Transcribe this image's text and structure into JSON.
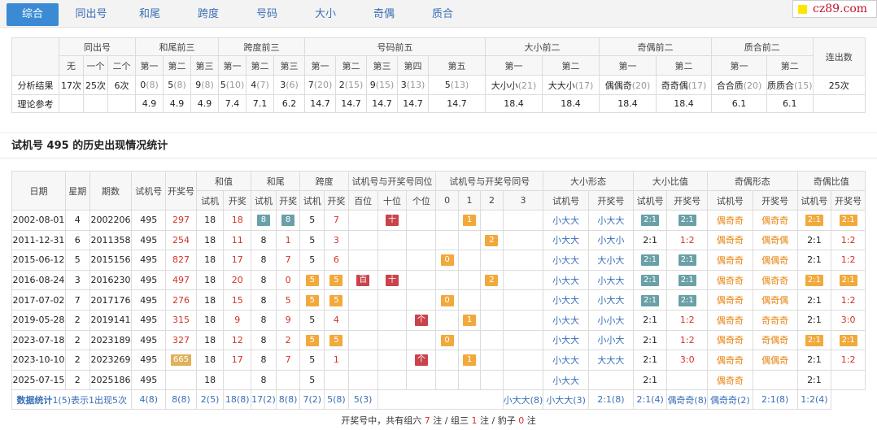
{
  "tabs": [
    "综合",
    "同出号",
    "和尾",
    "跨度",
    "号码",
    "大小",
    "奇偶",
    "质合"
  ],
  "logo": "cz89.com",
  "summary": {
    "groups": [
      "同出号",
      "和尾前三",
      "跨度前三",
      "号码前五",
      "大小前二",
      "奇偶前二",
      "质合前二",
      "连出数"
    ],
    "sub": [
      "无",
      "一个",
      "二个",
      "第一",
      "第二",
      "第三",
      "第一",
      "第二",
      "第三",
      "第一",
      "第二",
      "第三",
      "第四",
      "第五",
      "第一",
      "第二",
      "第一",
      "第二",
      "第一",
      "第二"
    ],
    "row1_label": "分析结果",
    "row1": [
      [
        "17次",
        ""
      ],
      [
        "25次",
        ""
      ],
      [
        "6次",
        ""
      ],
      [
        "0",
        "(8)"
      ],
      [
        "5",
        "(8)"
      ],
      [
        "9",
        "(8)"
      ],
      [
        "5",
        "(10)"
      ],
      [
        "4",
        "(7)"
      ],
      [
        "3",
        "(6)"
      ],
      [
        "7",
        "(20)"
      ],
      [
        "2",
        "(15)"
      ],
      [
        "9",
        "(15)"
      ],
      [
        "3",
        "(13)"
      ],
      [
        "5",
        "(13)"
      ],
      [
        "大小小",
        "(21)"
      ],
      [
        "大大小",
        "(17)"
      ],
      [
        "偶偶奇",
        "(20)"
      ],
      [
        "奇奇偶",
        "(17)"
      ],
      [
        "合合质",
        "(20)"
      ],
      [
        "质质合",
        "(15)"
      ],
      [
        "25次",
        ""
      ]
    ],
    "row2_label": "理论参考",
    "row2": [
      "",
      "",
      "",
      "4.9",
      "4.9",
      "4.9",
      "7.4",
      "7.1",
      "6.2",
      "14.7",
      "14.7",
      "14.7",
      "14.7",
      "14.7",
      "18.4",
      "18.4",
      "18.4",
      "18.4",
      "6.1",
      "6.1",
      ""
    ]
  },
  "section_title": "试机号 495 的历史出现情况统计",
  "hist": {
    "head1": [
      "日期",
      "星期",
      "期数",
      "试机号",
      "开奖号",
      "和值",
      "和尾",
      "跨度",
      "试机号与开奖号同位",
      "试机号与开奖号同号",
      "大小形态",
      "大小比值",
      "奇偶形态",
      "奇偶比值"
    ],
    "head2": [
      "试机",
      "开奖",
      "试机",
      "开奖",
      "试机",
      "开奖",
      "百位",
      "十位",
      "个位",
      "0",
      "1",
      "2",
      "3",
      "试机号",
      "开奖号",
      "试机号",
      "开奖号",
      "试机号",
      "开奖号",
      "试机号",
      "开奖号"
    ],
    "rows": [
      [
        "2002-08-01",
        "4",
        "2002206",
        "495",
        "297",
        "18",
        "18",
        "8",
        "8",
        "5",
        "7",
        "",
        "十",
        "",
        "",
        "1",
        "",
        "",
        "小大大",
        "小大大",
        "2:1",
        "2:1",
        "偶奇奇",
        "偶奇奇",
        "2:1",
        "2:1"
      ],
      [
        "2011-12-31",
        "6",
        "2011358",
        "495",
        "254",
        "18",
        "11",
        "8",
        "1",
        "5",
        "3",
        "",
        "",
        "",
        "",
        "",
        "2",
        "",
        "小大大",
        "小大小",
        "2:1",
        "1:2",
        "偶奇奇",
        "偶奇偶",
        "2:1",
        "1:2"
      ],
      [
        "2015-06-12",
        "5",
        "2015156",
        "495",
        "827",
        "18",
        "17",
        "8",
        "7",
        "5",
        "6",
        "",
        "",
        "",
        "0",
        "",
        "",
        "",
        "小大大",
        "大小大",
        "2:1",
        "2:1",
        "偶奇奇",
        "偶偶奇",
        "2:1",
        "1:2"
      ],
      [
        "2016-08-24",
        "3",
        "2016230",
        "495",
        "497",
        "18",
        "20",
        "8",
        "0",
        "5",
        "5",
        "百",
        "十",
        "",
        "",
        "",
        "2",
        "",
        "小大大",
        "小大大",
        "2:1",
        "2:1",
        "偶奇奇",
        "偶奇奇",
        "2:1",
        "2:1"
      ],
      [
        "2017-07-02",
        "7",
        "2017176",
        "495",
        "276",
        "18",
        "15",
        "8",
        "5",
        "5",
        "5",
        "",
        "",
        "",
        "0",
        "",
        "",
        "",
        "小大大",
        "小大大",
        "2:1",
        "2:1",
        "偶奇奇",
        "偶奇偶",
        "2:1",
        "1:2"
      ],
      [
        "2019-05-28",
        "2",
        "2019141",
        "495",
        "315",
        "18",
        "9",
        "8",
        "9",
        "5",
        "4",
        "",
        "",
        "个",
        "",
        "1",
        "",
        "",
        "小大大",
        "小小大",
        "2:1",
        "1:2",
        "偶奇奇",
        "奇奇奇",
        "2:1",
        "3:0"
      ],
      [
        "2023-07-18",
        "2",
        "2023189",
        "495",
        "327",
        "18",
        "12",
        "8",
        "2",
        "5",
        "5",
        "",
        "",
        "",
        "0",
        "",
        "",
        "",
        "小大大",
        "小小大",
        "2:1",
        "1:2",
        "偶奇奇",
        "奇偶奇",
        "2:1",
        "2:1"
      ],
      [
        "2023-10-10",
        "2",
        "2023269",
        "495",
        "665",
        "18",
        "17",
        "8",
        "7",
        "5",
        "1",
        "",
        "",
        "个",
        "",
        "1",
        "",
        "",
        "小大大",
        "大大大",
        "2:1",
        "3:0",
        "偶奇奇",
        "偶偶奇",
        "2:1",
        "1:2"
      ],
      [
        "2025-07-15",
        "2",
        "2025186",
        "495",
        "",
        "18",
        "",
        "8",
        "",
        "5",
        "",
        "",
        "",
        "",
        "",
        "",
        "",
        "",
        "小大大",
        "",
        "2:1",
        "",
        "偶奇奇",
        "",
        "2:1",
        ""
      ]
    ],
    "stat_label": "数据统计",
    "stat_note": "1(5)表示1出现5次",
    "stats": [
      "4(8)",
      "8(8)",
      "2(5)",
      "18(8)",
      "17(2)",
      "8(8)",
      "7(2)",
      "5(8)",
      "5(3)",
      "小大大(8)",
      "小大大(3)",
      "2:1(8)",
      "2:1(4)",
      "偶奇奇(8)",
      "偶奇奇(2)",
      "2:1(8)",
      "1:2(4)"
    ]
  },
  "footer": {
    "pre": "开奖号中，共有组六 ",
    "n6": "7",
    "mid1": " 注 / 组三 ",
    "n3": "1",
    "mid2": " 注 / 豹子 ",
    "nb": "0",
    "post": " 注"
  }
}
